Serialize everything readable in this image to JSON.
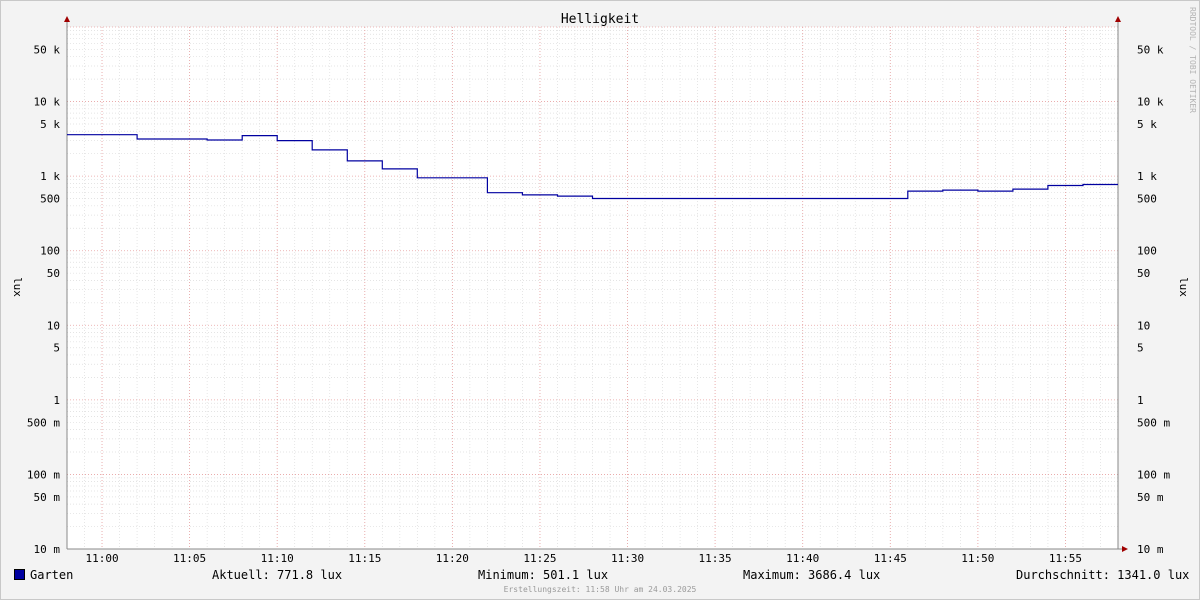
{
  "chart_data": {
    "type": "line",
    "title": "Helligkeit",
    "ylabel": "lux",
    "yscale": "log",
    "ylim": [
      0.01,
      100000
    ],
    "xlim": [
      "10:58",
      "11:58"
    ],
    "x_ticks": [
      "11:00",
      "11:05",
      "11:10",
      "11:15",
      "11:20",
      "11:25",
      "11:30",
      "11:35",
      "11:40",
      "11:45",
      "11:50",
      "11:55"
    ],
    "y_ticks": [
      {
        "value": 50000,
        "label": "50 k"
      },
      {
        "value": 10000,
        "label": "10 k"
      },
      {
        "value": 5000,
        "label": "5 k"
      },
      {
        "value": 1000,
        "label": "1 k"
      },
      {
        "value": 500,
        "label": "500"
      },
      {
        "value": 100,
        "label": "100"
      },
      {
        "value": 50,
        "label": "50"
      },
      {
        "value": 10,
        "label": "10"
      },
      {
        "value": 5,
        "label": "5"
      },
      {
        "value": 1,
        "label": "1"
      },
      {
        "value": 0.5,
        "label": "500 m"
      },
      {
        "value": 0.1,
        "label": "100 m"
      },
      {
        "value": 0.05,
        "label": "50 m"
      },
      {
        "value": 0.01,
        "label": "10 m"
      }
    ],
    "grid": true,
    "series": [
      {
        "name": "Garten",
        "color": "#0000a0",
        "step": true,
        "x": [
          "10:58",
          "11:02",
          "11:06",
          "11:08",
          "11:10",
          "11:12",
          "11:14",
          "11:16",
          "11:18",
          "11:22",
          "11:24",
          "11:26",
          "11:28",
          "11:46",
          "11:48",
          "11:50",
          "11:52",
          "11:54",
          "11:56",
          "11:58"
        ],
        "values": [
          3600,
          3150,
          3050,
          3500,
          3000,
          2250,
          1600,
          1250,
          950,
          600,
          560,
          540,
          501,
          630,
          650,
          630,
          670,
          750,
          772,
          772
        ]
      }
    ],
    "legend": {
      "label": "Garten",
      "aktuell": "Aktuell: 771.8 lux",
      "minimum": "Minimum: 501.1 lux",
      "maximum": "Maximum: 3686.4 lux",
      "durchschnitt": "Durchschnitt: 1341.0 lux"
    }
  },
  "watermark": "RRDTOOL / TOBI OETIKER",
  "footer": "Erstellungszeit: 11:58 Uhr am 24.03.2025"
}
